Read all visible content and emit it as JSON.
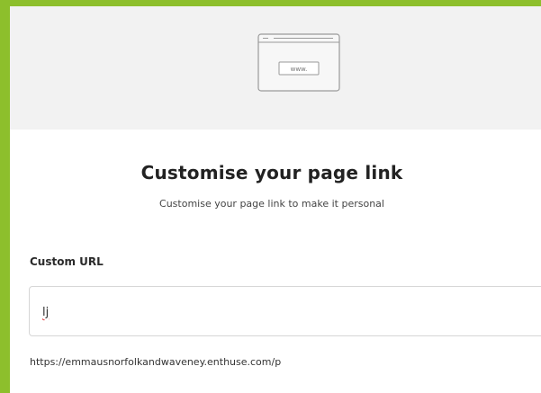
{
  "illustration": {
    "icon": "browser-window-icon",
    "address_text": "www."
  },
  "title": "Customise your page link",
  "subtitle": "Customise your page link to make it personal",
  "custom_url": {
    "label": "Custom URL",
    "value": "lj"
  },
  "url_preview": "https://emmausnorfolkandwaveney.enthuse.com/p",
  "colors": {
    "accent_border": "#8dbf2c",
    "header_background": "#f2f2f2"
  }
}
